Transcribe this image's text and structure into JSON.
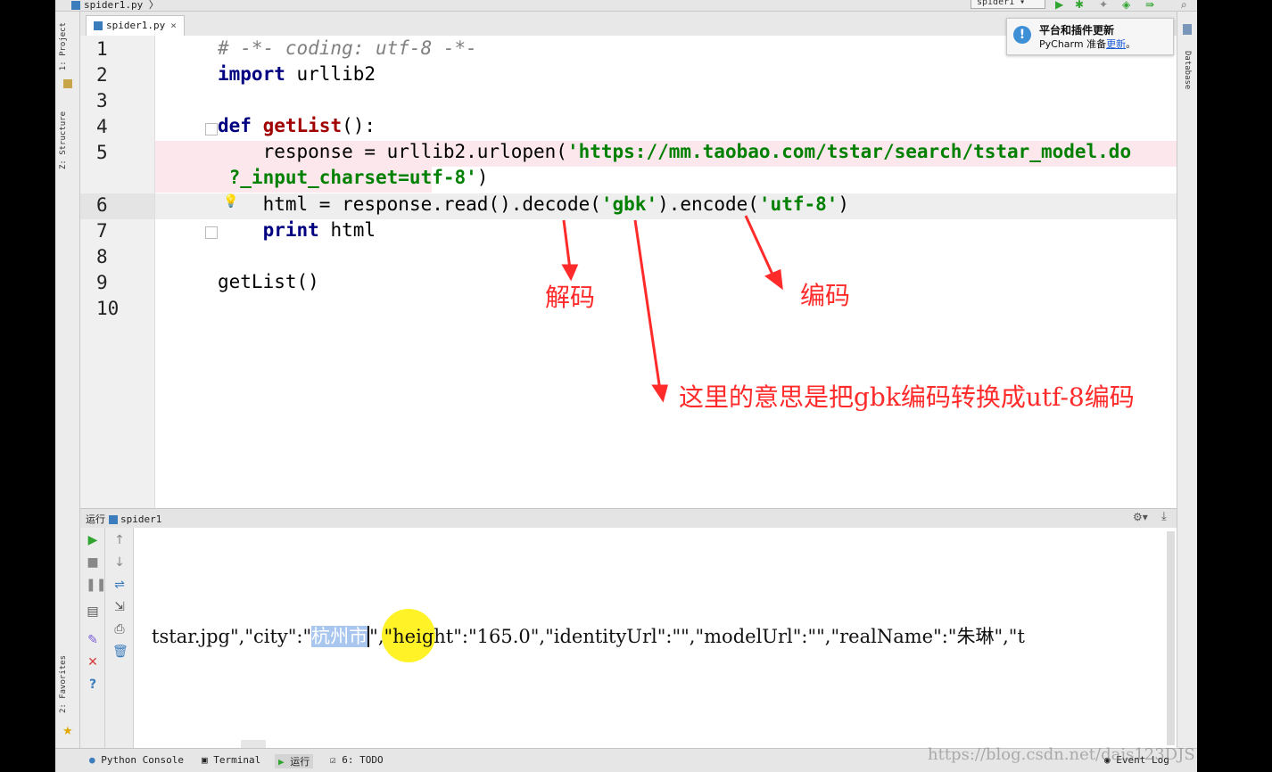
{
  "window": {
    "breadcrumb": "spider1.py",
    "run_config": "spider1"
  },
  "left_tools": {
    "project": "1: Project",
    "structure": "Z: Structure",
    "favorites": "2: Favorites"
  },
  "right_tools": {
    "database": "Database"
  },
  "editor": {
    "tab_label": "spider1.py",
    "tab_close": "×",
    "lines": [
      {
        "n": "1",
        "text": "# -*- coding: utf-8 -*-"
      },
      {
        "n": "2",
        "kw": "import",
        "rest": " urllib2"
      },
      {
        "n": "3"
      },
      {
        "n": "4",
        "kw": "def",
        "fn": "getList",
        "rest": "():"
      },
      {
        "n": "5",
        "pre": "    response = urllib2.urlopen(",
        "str": "'https://mm.taobao.com/tstar/search/tstar_model.do"
      },
      {
        "n": "",
        "str": " ?_input_charset=utf-8'",
        "rest": ")"
      },
      {
        "n": "6",
        "pre": "    ",
        "kw": "html",
        "mid": " = response.read().decode(",
        "s1": "'gbk'",
        "mid2": ").encode(",
        "s2": "'utf-8'",
        "end": ")"
      },
      {
        "n": "7",
        "pre": "    ",
        "kw": "print",
        "rest": " html"
      },
      {
        "n": "8"
      },
      {
        "n": "9",
        "rest": "getList()"
      },
      {
        "n": "10"
      }
    ]
  },
  "annotations": {
    "decode": "解码",
    "encode": "编码",
    "explain": "这里的意思是把gbk编码转换成utf-8编码",
    "color": "#ff2a2a"
  },
  "notification": {
    "title": "平台和插件更新",
    "body": "PyCharm 准备",
    "link": "更新",
    "tail": "。"
  },
  "run_panel": {
    "header": "运行",
    "config": "spider1",
    "output_before": "tstar.jpg\",\"city\":\"",
    "output_selected": "杭州市",
    "output_after": "\",\"height\":\"165.0\",\"identityUrl\":\"\",\"modelUrl\":\"\",\"realName\":\"朱琳\",\"t"
  },
  "bottom_tabs": {
    "python_console": "Python Console",
    "terminal": "Terminal",
    "run": "运行",
    "todo": "6: TODO",
    "event_log": "Event Log"
  },
  "watermark": "https://blog.csdn.net/dais123DJS"
}
